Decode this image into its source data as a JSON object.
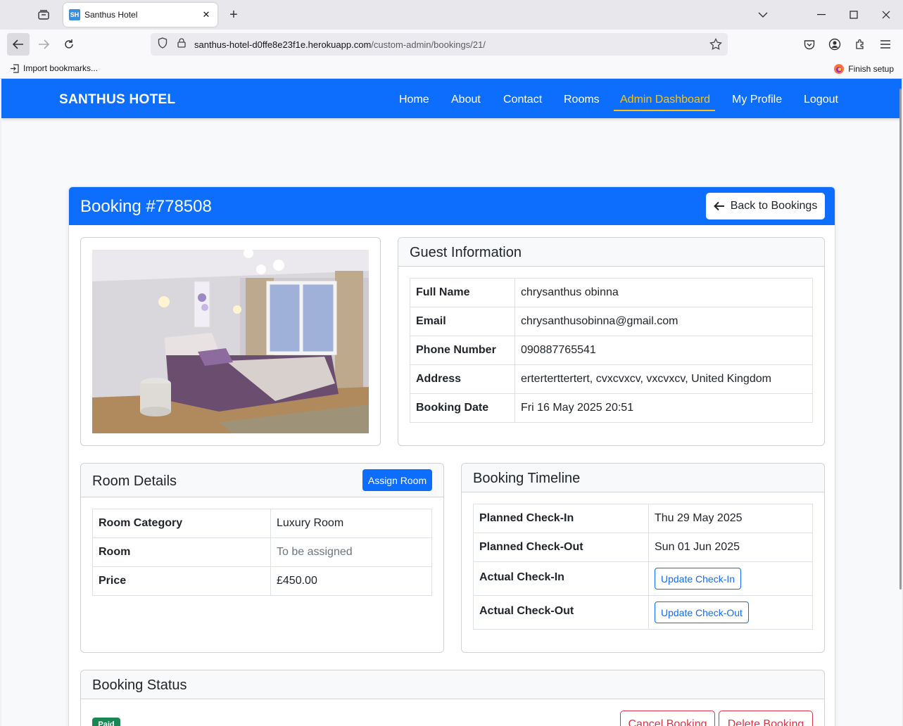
{
  "browser": {
    "tab_title": "Santhus Hotel",
    "favicon_text": "SH",
    "url_host": "santhus-hotel-d0ffe8e23f1e.herokuapp.com",
    "url_path": "/custom-admin/bookings/21/",
    "bookmark_import": "Import bookmarks...",
    "finish_setup": "Finish setup"
  },
  "site": {
    "brand": "SANTHUS HOTEL",
    "nav": [
      "Home",
      "About",
      "Contact",
      "Rooms",
      "Admin Dashboard",
      "My Profile",
      "Logout"
    ],
    "active_nav": "Admin Dashboard"
  },
  "booking": {
    "title": "Booking #778508",
    "back_label": "Back to Bookings"
  },
  "guest": {
    "heading": "Guest Information",
    "rows": [
      {
        "label": "Full Name",
        "value": "chrysanthus obinna"
      },
      {
        "label": "Email",
        "value": "chrysanthusobinna@gmail.com"
      },
      {
        "label": "Phone Number",
        "value": "090887765541"
      },
      {
        "label": "Address",
        "value": "erterterttertert, cvxcvxcv, vxcvxcv, United Kingdom"
      },
      {
        "label": "Booking Date",
        "value": "Fri 16 May 2025 20:51"
      }
    ]
  },
  "room": {
    "heading": "Room Details",
    "assign_label": "Assign Room",
    "rows": [
      {
        "label": "Room Category",
        "value": "Luxury Room"
      },
      {
        "label": "Room",
        "value": "To be assigned"
      },
      {
        "label": "Price",
        "value": "£450.00"
      }
    ]
  },
  "timeline": {
    "heading": "Booking Timeline",
    "rows": [
      {
        "label": "Planned Check-In",
        "value": "Thu 29 May 2025"
      },
      {
        "label": "Planned Check-Out",
        "value": "Sun 01 Jun 2025"
      },
      {
        "label": "Actual Check-In",
        "button": "Update Check-In"
      },
      {
        "label": "Actual Check-Out",
        "button": "Update Check-Out"
      }
    ]
  },
  "status": {
    "heading": "Booking Status",
    "badge": "Paid",
    "cancel_label": "Cancel Booking",
    "delete_label": "Delete Booking"
  },
  "colors": {
    "primary": "#0d6efd",
    "active_nav": "#ffc107",
    "success": "#198754",
    "danger": "#dc3545"
  }
}
